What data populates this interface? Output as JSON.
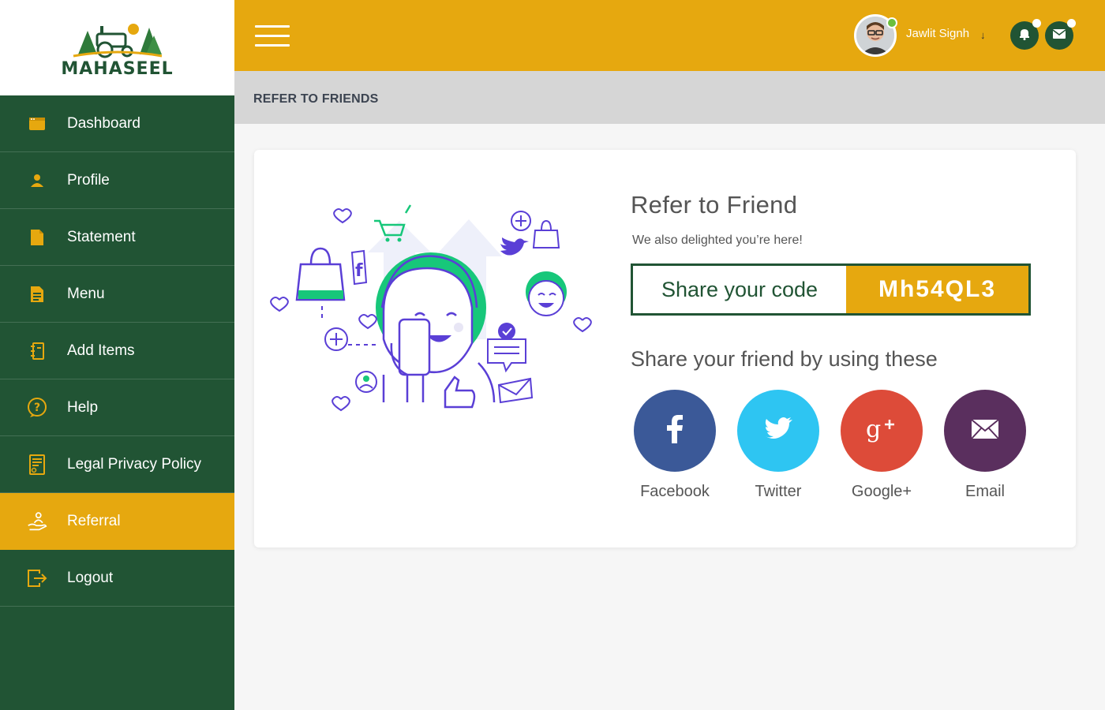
{
  "brand": {
    "name": "MAHASEEL"
  },
  "sidebar": {
    "items": [
      {
        "label": "Dashboard",
        "icon": "dashboard-icon"
      },
      {
        "label": "Profile",
        "icon": "user-icon"
      },
      {
        "label": "Statement",
        "icon": "document-icon"
      },
      {
        "label": "Menu",
        "icon": "menu-list-icon"
      },
      {
        "label": "Add Items",
        "icon": "add-items-icon"
      },
      {
        "label": "Help",
        "icon": "help-icon"
      },
      {
        "label": "Legal Privacy Policy",
        "icon": "policy-icon"
      },
      {
        "label": "Referral",
        "icon": "referral-icon",
        "active": true
      },
      {
        "label": "Logout",
        "icon": "logout-icon"
      }
    ]
  },
  "header": {
    "user_name": "Jawlit Signh",
    "caret": "↓"
  },
  "breadcrumb": "REFER TO FRIENDS",
  "referral": {
    "title": "Refer to Friend",
    "subtitle": "We also delighted  you’re here!",
    "code_label": "Share your code",
    "code": "Mh54QL3",
    "share_title": "Share your friend by using these",
    "share": [
      {
        "label": "Facebook",
        "color": "#3b5998",
        "icon": "facebook-icon"
      },
      {
        "label": "Twitter",
        "color": "#2ec5f2",
        "icon": "twitter-icon"
      },
      {
        "label": "Google+",
        "color": "#dd4b39",
        "icon": "google-plus-icon"
      },
      {
        "label": "Email",
        "color": "#5a2f5e",
        "icon": "email-icon"
      }
    ]
  },
  "colors": {
    "primary_green": "#215434",
    "accent_yellow": "#e6a80f",
    "illustration_purple": "#5a3fd6",
    "illustration_green": "#17c77a"
  }
}
